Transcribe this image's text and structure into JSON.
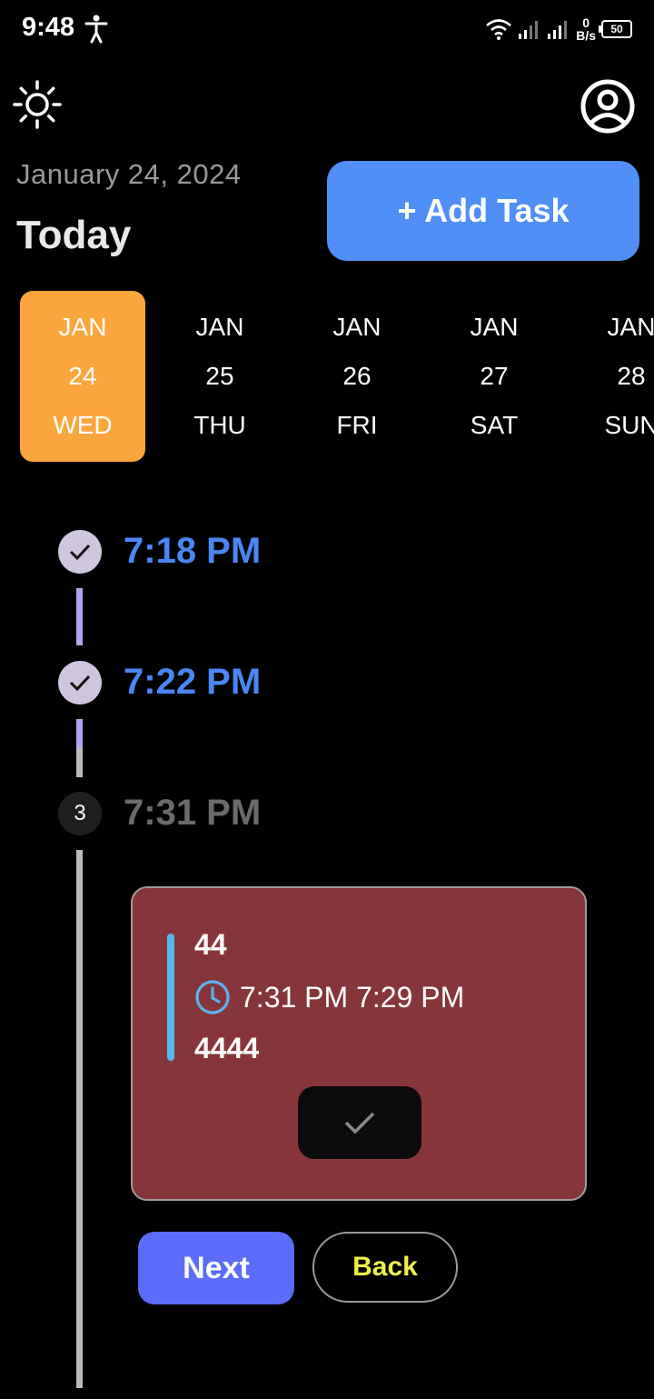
{
  "status_bar": {
    "time": "9:48",
    "speed_value": "0",
    "speed_unit": "B/s",
    "battery": "50"
  },
  "header": {
    "date": "January 24, 2024",
    "title": "Today",
    "add_task_label": "+ Add Task"
  },
  "date_strip": {
    "days": [
      {
        "month": "JAN",
        "day": "24",
        "weekday": "WED",
        "selected": true
      },
      {
        "month": "JAN",
        "day": "25",
        "weekday": "THU",
        "selected": false
      },
      {
        "month": "JAN",
        "day": "26",
        "weekday": "FRI",
        "selected": false
      },
      {
        "month": "JAN",
        "day": "27",
        "weekday": "SAT",
        "selected": false
      },
      {
        "month": "JAN",
        "day": "28",
        "weekday": "SUN",
        "selected": false
      }
    ]
  },
  "timeline": {
    "steps": [
      {
        "time": "7:18 PM",
        "state": "done"
      },
      {
        "time": "7:22 PM",
        "state": "done"
      },
      {
        "time": "7:31 PM",
        "state": "current",
        "number": "3"
      }
    ]
  },
  "task_card": {
    "title": "44",
    "time_range": "7:31 PM 7:29 PM",
    "description": "4444"
  },
  "actions": {
    "next_label": "Next",
    "back_label": "Back"
  },
  "colors": {
    "accent_blue": "#4f8ff6",
    "selected_day": "#fba63c",
    "card_bg": "#86363b",
    "next_button": "#5b6cf8",
    "back_text": "#eef04a"
  }
}
